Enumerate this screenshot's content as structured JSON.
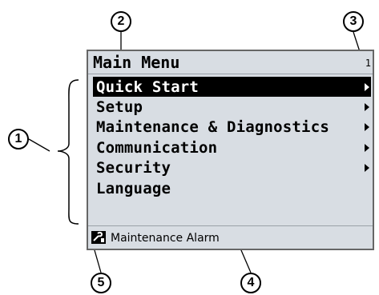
{
  "callouts": {
    "one": "1",
    "two": "2",
    "three": "3",
    "four": "4",
    "five": "5"
  },
  "header": {
    "title": "Main Menu",
    "page_number": "1"
  },
  "menu": {
    "items": [
      {
        "label": "Quick Start",
        "selected": true,
        "has_submenu": true
      },
      {
        "label": "Setup",
        "selected": false,
        "has_submenu": true
      },
      {
        "label": "Maintenance & Diagnostics",
        "selected": false,
        "has_submenu": true
      },
      {
        "label": "Communication",
        "selected": false,
        "has_submenu": true
      },
      {
        "label": "Security",
        "selected": false,
        "has_submenu": true
      },
      {
        "label": "Language",
        "selected": false,
        "has_submenu": false
      }
    ]
  },
  "status": {
    "icon": "maintenance-wrench-icon",
    "text": "Maintenance Alarm"
  },
  "colors": {
    "screen_bg": "#d8dde3",
    "selection": "#000000"
  }
}
